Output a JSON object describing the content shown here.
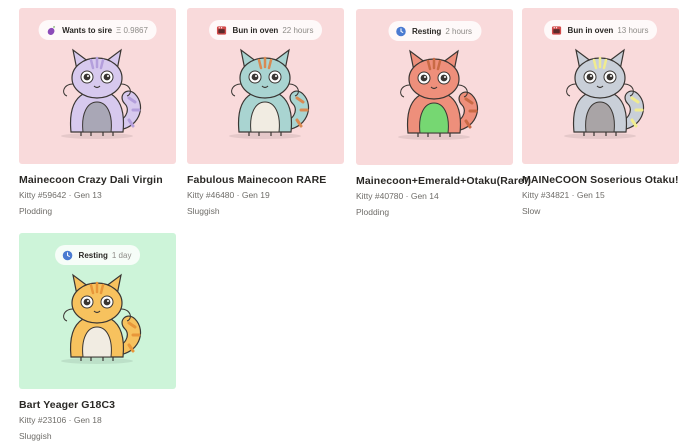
{
  "kitties": [
    {
      "name": "Mainecoon Crazy Dali Virgin",
      "kitty_id": "Kitty #59642",
      "generation": "Gen 13",
      "cooldown": "Plodding",
      "badge": {
        "label": "Wants to sire",
        "detail": "Ξ 0.9867",
        "icon": "eggplant-icon"
      },
      "bg": "#f9dadb",
      "colors": {
        "body": "#d7c9ee",
        "belly": "#a9a7b6",
        "accent": "#b49fdc"
      }
    },
    {
      "name": "Fabulous Mainecoon RARE",
      "kitty_id": "Kitty #46480",
      "generation": "Gen 19",
      "cooldown": "Sluggish",
      "badge": {
        "label": "Bun in oven",
        "detail": "22 hours",
        "icon": "oven-icon"
      },
      "bg": "#f9dadb",
      "colors": {
        "body": "#a9d4d1",
        "belly": "#f1ece2",
        "accent": "#d98a52"
      }
    },
    {
      "name": "Mainecoon+Emerald+Otaku(Rare!)",
      "kitty_id": "Kitty #40780",
      "generation": "Gen 14",
      "cooldown": "Plodding",
      "badge": {
        "label": "Resting",
        "detail": "2 hours",
        "icon": "clock-icon"
      },
      "bg": "#f9dadb",
      "colors": {
        "body": "#ee8f7b",
        "belly": "#76d772",
        "accent": "#c96a45"
      }
    },
    {
      "name": "MAINeCOON Soserious Otaku!",
      "kitty_id": "Kitty #34821",
      "generation": "Gen 15",
      "cooldown": "Slow",
      "badge": {
        "label": "Bun in oven",
        "detail": "13 hours",
        "icon": "oven-icon"
      },
      "bg": "#f9dadb",
      "colors": {
        "body": "#c9cfd8",
        "belly": "#a9a4a6",
        "accent": "#f1ec8e"
      }
    },
    {
      "name": "Bart Yeager G18C3",
      "kitty_id": "Kitty #23106",
      "generation": "Gen 18",
      "cooldown": "Sluggish",
      "badge": {
        "label": "Resting",
        "detail": "1 day",
        "icon": "clock-icon"
      },
      "bg": "#cdf4d9",
      "colors": {
        "body": "#f7c25e",
        "belly": "#f1ece2",
        "accent": "#e8973a"
      }
    }
  ],
  "separator": " · "
}
